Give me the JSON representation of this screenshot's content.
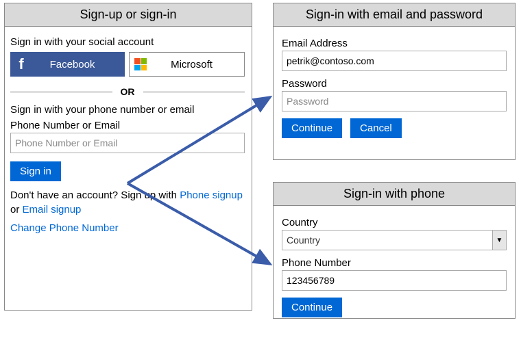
{
  "left": {
    "title": "Sign-up or sign-in",
    "social_heading": "Sign in with your social account",
    "facebook_label": "Facebook",
    "microsoft_label": "Microsoft",
    "or_text": "OR",
    "phone_email_heading": "Sign in with your phone number or email",
    "phone_email_label": "Phone Number or Email",
    "phone_email_placeholder": "Phone Number or Email",
    "signin_label": "Sign in",
    "signup_prefix": "Don't have an account? Sign up with ",
    "phone_signup_link": "Phone signup",
    "signup_or": " or ",
    "email_signup_link": "Email signup",
    "change_phone_link": "Change Phone Number"
  },
  "email_panel": {
    "title": "Sign-in with email and password",
    "email_label": "Email Address",
    "email_value": "petrik@contoso.com",
    "password_label": "Password",
    "password_placeholder": "Password",
    "continue_label": "Continue",
    "cancel_label": "Cancel"
  },
  "phone_panel": {
    "title": "Sign-in with phone",
    "country_label": "Country",
    "country_selected": "Country",
    "phone_label": "Phone Number",
    "phone_value": "123456789",
    "continue_label": "Continue"
  },
  "colors": {
    "header_bg": "#d9d9d9",
    "blue_btn": "#0067d4",
    "facebook": "#3b5998",
    "link": "#0067d4",
    "arrow": "#3a5ca9"
  }
}
